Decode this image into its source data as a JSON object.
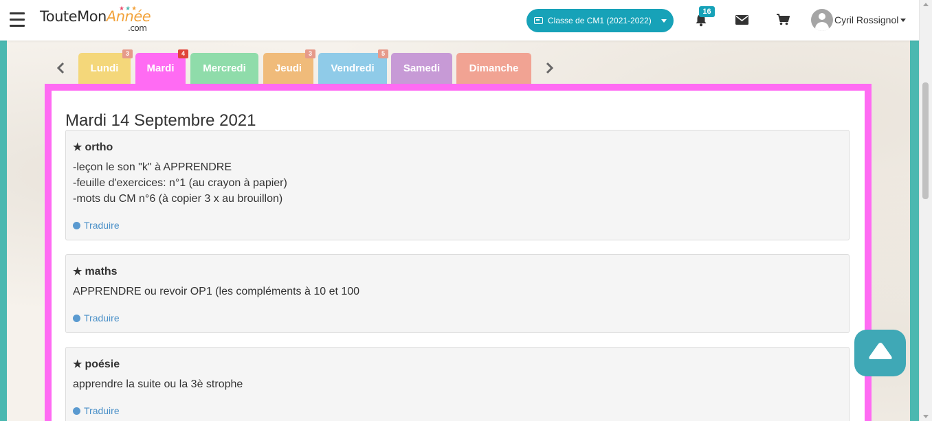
{
  "header": {
    "logo": {
      "part1": "ToutemonAnnée",
      "part_a": "Toute",
      "part_b": "Mon",
      "part_c": "Année",
      "suffix": ".com"
    },
    "class_selector": {
      "label": "Classe de CM1 (2021-2022)"
    },
    "notifications": {
      "count": "16"
    },
    "user": {
      "name": "Cyril Rossignol"
    }
  },
  "tabs": [
    {
      "label": "Lundi",
      "badge": "3",
      "color": "#f4d77a",
      "badge_color": "#e69a8a"
    },
    {
      "label": "Mardi",
      "badge": "4",
      "color": "#ff6bf3",
      "badge_color": "#e0443a"
    },
    {
      "label": "Mercredi",
      "badge": "",
      "color": "#8fdcaa",
      "badge_color": ""
    },
    {
      "label": "Jeudi",
      "badge": "3",
      "color": "#f0bb7a",
      "badge_color": "#e69a8a"
    },
    {
      "label": "Vendredi",
      "badge": "5",
      "color": "#8fcbe8",
      "badge_color": "#e69a8a"
    },
    {
      "label": "Samedi",
      "badge": "",
      "color": "#c79ad6",
      "badge_color": ""
    },
    {
      "label": "Dimanche",
      "badge": "",
      "color": "#f1a393",
      "badge_color": ""
    }
  ],
  "day": {
    "title": "Mardi 14 Septembre 2021"
  },
  "tasks": [
    {
      "subject": "ortho",
      "lines": [
        "-leçon le son \"k\" à APPRENDRE",
        "-feuille d'exercices: n°1 (au crayon à papier)",
        "-mots du CM n°6 (à copier 3 x au brouillon)"
      ],
      "translate": "Traduire"
    },
    {
      "subject": "maths",
      "lines": [
        "APPRENDRE ou revoir OP1 (les compléments à 10 et 100"
      ],
      "translate": "Traduire"
    },
    {
      "subject": "poésie",
      "lines": [
        "apprendre la suite ou la 3è strophe"
      ],
      "translate": "Traduire"
    }
  ],
  "colors": {
    "accent": "#17a2b8",
    "active_frame": "#ff6bf3",
    "link": "#4a90c8",
    "fab": "#3fa8b6"
  }
}
